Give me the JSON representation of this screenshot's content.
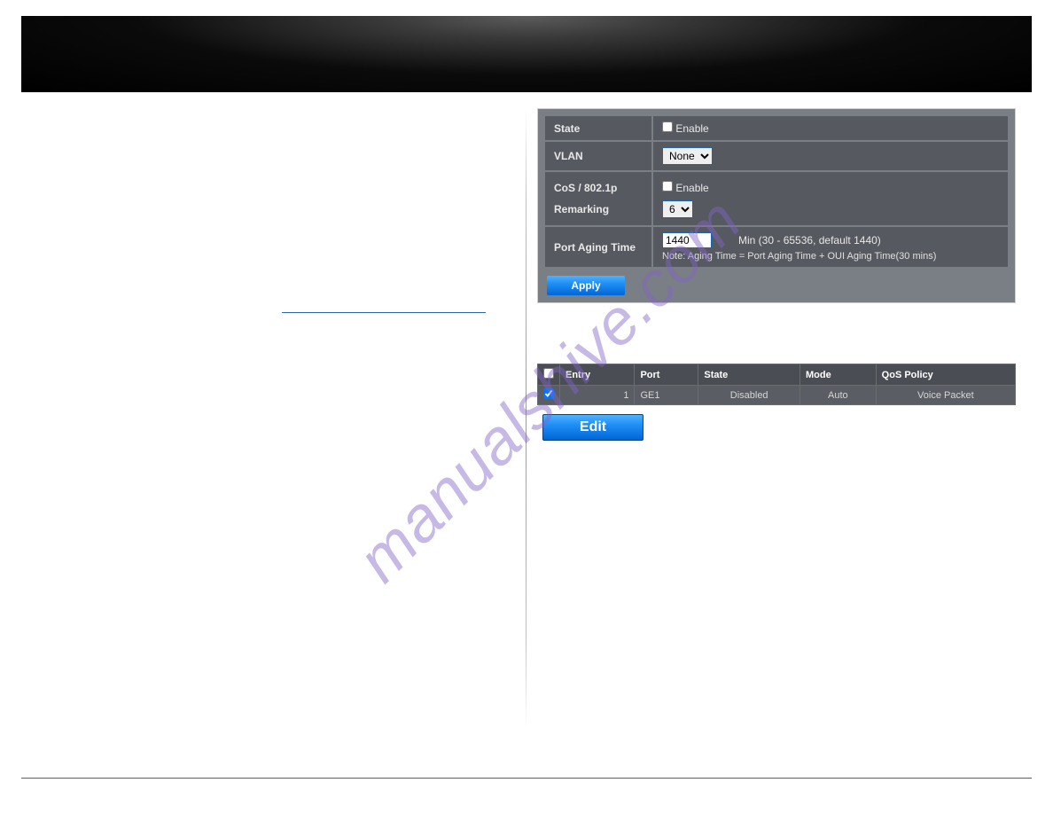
{
  "config_panel": {
    "rows": {
      "state": {
        "label": "State",
        "checkbox_label": "Enable"
      },
      "vlan": {
        "label": "VLAN",
        "select_value": "None"
      },
      "cos": {
        "label": "CoS / 802.1p Remarking",
        "checkbox_label": "Enable",
        "select_value": "6"
      },
      "aging": {
        "label": "Port Aging Time",
        "input_value": "1440",
        "range_text": "Min (30 - 65536, default 1440)",
        "note_text": "Note: Aging Time = Port Aging Time + OUI Aging Time(30 mins)"
      }
    },
    "apply_label": "Apply"
  },
  "port_table": {
    "headers": {
      "entry": "Entry",
      "port": "Port",
      "state": "State",
      "mode": "Mode",
      "qos": "QoS Policy"
    },
    "row": {
      "entry": "1",
      "port": "GE1",
      "state": "Disabled",
      "mode": "Auto",
      "qos": "Voice Packet"
    },
    "edit_label": "Edit"
  },
  "watermark": "manualshive.com"
}
